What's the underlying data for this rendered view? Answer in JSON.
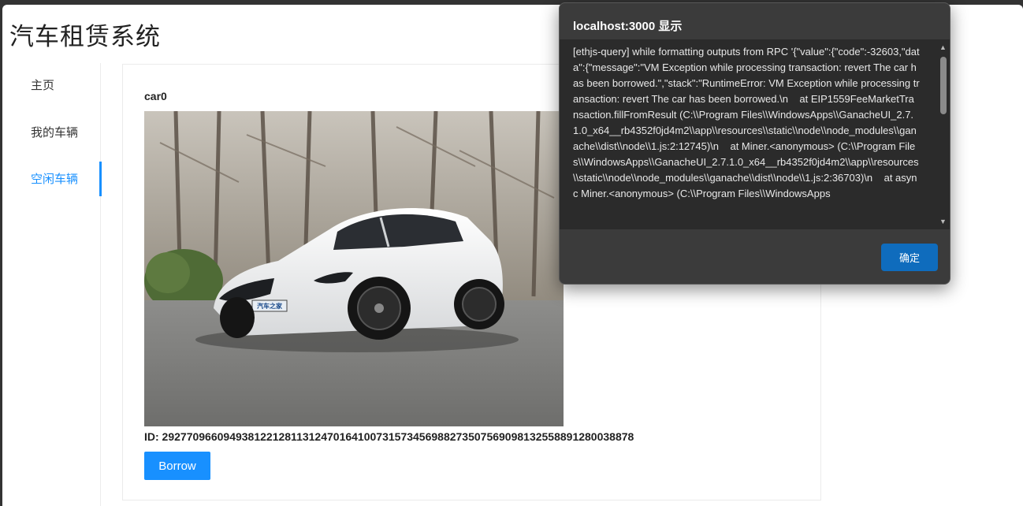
{
  "app": {
    "title": "汽车租赁系统"
  },
  "sidebar": {
    "items": [
      {
        "label": "主页"
      },
      {
        "label": "我的车辆"
      },
      {
        "label": "空闲车辆"
      }
    ]
  },
  "car": {
    "name": "car0",
    "id_text": "ID: 29277096609493812212811312470164100731573456988273507569098132558891280038878",
    "borrow_label": "Borrow",
    "image_plate_text": "汽车之家"
  },
  "dialog": {
    "title": "localhost:3000 显示",
    "message": "[ethjs-query] while formatting outputs from RPC '{\"value\":{\"code\":-32603,\"data\":{\"message\":\"VM Exception while processing transaction: revert The car has been borrowed.\",\"stack\":\"RuntimeError: VM Exception while processing transaction: revert The car has been borrowed.\\n    at EIP1559FeeMarketTransaction.fillFromResult (C:\\\\Program Files\\\\WindowsApps\\\\GanacheUI_2.7.1.0_x64__rb4352f0jd4m2\\\\app\\\\resources\\\\static\\\\node\\\\node_modules\\\\ganache\\\\dist\\\\node\\\\1.js:2:12745)\\n    at Miner.<anonymous> (C:\\\\Program Files\\\\WindowsApps\\\\GanacheUI_2.7.1.0_x64__rb4352f0jd4m2\\\\app\\\\resources\\\\static\\\\node\\\\node_modules\\\\ganache\\\\dist\\\\node\\\\1.js:2:36703)\\n    at async Miner.<anonymous> (C:\\\\Program Files\\\\WindowsApps",
    "ok_label": "确定"
  }
}
